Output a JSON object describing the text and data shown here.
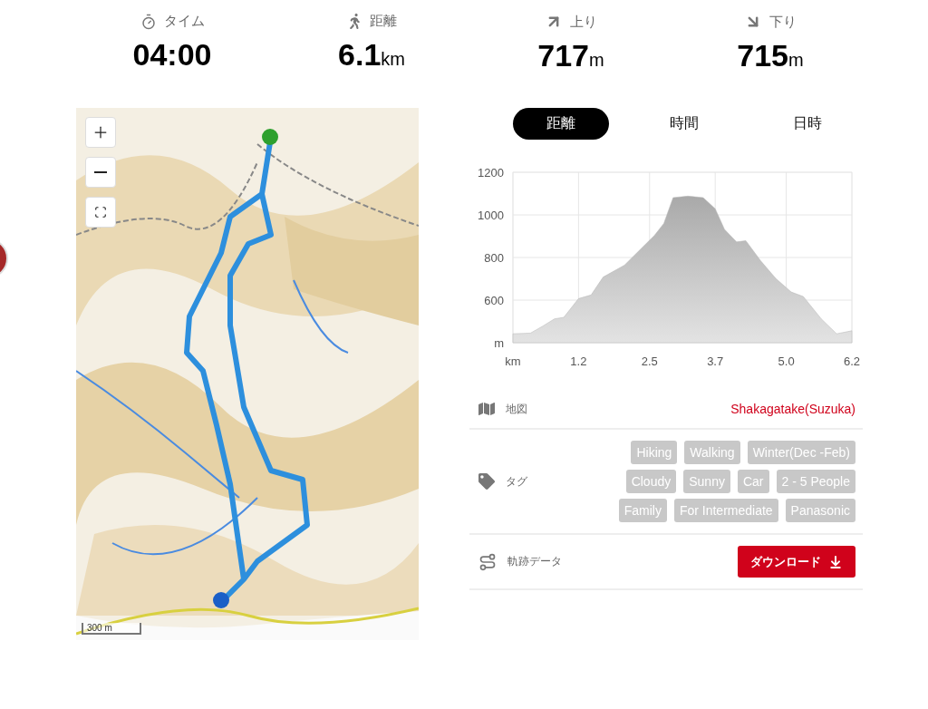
{
  "stats": [
    {
      "kind": "time",
      "label": "タイム",
      "value": "04:00"
    },
    {
      "kind": "distance",
      "label": "距離",
      "value": "6.1",
      "unit": "km"
    },
    {
      "kind": "ascent",
      "label": "上り",
      "value": "717",
      "unit": "m"
    },
    {
      "kind": "descent",
      "label": "下り",
      "value": "715",
      "unit": "m"
    }
  ],
  "map": {
    "kind": "picture",
    "scale": "300 m"
  },
  "tabs": [
    {
      "label": "距離",
      "selected": true
    },
    {
      "label": "時間",
      "selected": false
    },
    {
      "label": "日時",
      "selected": false
    }
  ],
  "profile": {
    "chart_data": {
      "type": "area",
      "xlim": [
        0,
        6.2
      ],
      "ylim": [
        400,
        1200
      ],
      "xticks": [
        {
          "value": 0,
          "label": "km"
        },
        1.2,
        2.5,
        3.7,
        {
          "value": 5.0,
          "label": "5.0"
        },
        6.2
      ],
      "yticks": [
        {
          "value": 400,
          "label": "m"
        },
        600,
        800,
        1000,
        1200
      ],
      "x": [
        0,
        0.32,
        0.54,
        0.76,
        0.93,
        1.2,
        1.43,
        1.65,
        2.04,
        2.26,
        2.59,
        2.76,
        2.93,
        3.2,
        3.48,
        3.7,
        3.87,
        4.09,
        4.26,
        4.53,
        4.81,
        5.09,
        5.31,
        5.64,
        5.92,
        6.2
      ],
      "grid": true,
      "series": [
        {
          "color": "#b5b5b5",
          "values": [
            442,
            445,
            477,
            512,
            519,
            607,
            624,
            708,
            764,
            820,
            904,
            960,
            1081,
            1088,
            1081,
            1029,
            932,
            873,
            879,
            785,
            701,
            638,
            617,
            512,
            442,
            456
          ]
        }
      ]
    }
  },
  "info": [
    {
      "kind": "map",
      "label": "地図",
      "value": "Shakagatake(Suzuka)"
    },
    {
      "kind": "tags",
      "label": "タグ",
      "tags": [
        "Hiking",
        "Walking",
        "Winter(Dec -Feb)",
        "Cloudy",
        "Sunny",
        "Car",
        "2 - 5 People",
        "Family",
        "For Intermediate",
        "Panasonic"
      ]
    },
    {
      "kind": "track",
      "label": "軌跡データ",
      "button": "ダウンロード"
    }
  ]
}
